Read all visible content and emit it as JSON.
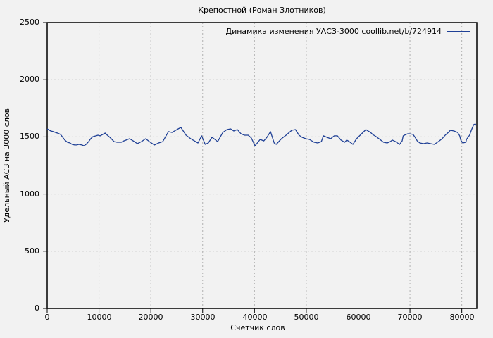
{
  "chart_data": {
    "type": "line",
    "title": "Крепостной (Роман Злотников)",
    "xlabel": "Счетчик слов",
    "ylabel": "Удельный АСЗ на 3000 слов",
    "legend": {
      "label": "Динамика изменения УАСЗ-3000 coollib.net/b/724914",
      "position": "top-right-inside"
    },
    "xlim": [
      0,
      82900
    ],
    "ylim": [
      0,
      2500
    ],
    "xticks": [
      0,
      10000,
      20000,
      30000,
      40000,
      50000,
      60000,
      70000,
      80000
    ],
    "yticks_display": [
      2500,
      2000,
      1500,
      1000,
      500,
      0
    ],
    "grid": true,
    "colors": {
      "background": "#f2f2f2",
      "gridline": "#b0b0b0",
      "axis": "#000000"
    },
    "series": [
      {
        "name": "Динамика изменения УАСЗ-3000 coollib.net/b/724914",
        "color": "#1f4096",
        "points": [
          [
            0,
            1570
          ],
          [
            700,
            1552
          ],
          [
            1200,
            1546
          ],
          [
            1600,
            1539
          ],
          [
            2000,
            1533
          ],
          [
            2600,
            1521
          ],
          [
            3000,
            1496
          ],
          [
            3400,
            1472
          ],
          [
            3900,
            1453
          ],
          [
            4400,
            1447
          ],
          [
            4800,
            1435
          ],
          [
            5300,
            1429
          ],
          [
            5700,
            1429
          ],
          [
            6100,
            1435
          ],
          [
            6700,
            1429
          ],
          [
            7100,
            1422
          ],
          [
            7500,
            1435
          ],
          [
            8000,
            1459
          ],
          [
            8400,
            1484
          ],
          [
            8800,
            1502
          ],
          [
            9400,
            1509
          ],
          [
            9800,
            1515
          ],
          [
            10200,
            1509
          ],
          [
            10700,
            1521
          ],
          [
            11200,
            1533
          ],
          [
            11600,
            1515
          ],
          [
            12100,
            1496
          ],
          [
            12500,
            1478
          ],
          [
            12900,
            1459
          ],
          [
            13500,
            1453
          ],
          [
            14300,
            1453
          ],
          [
            14800,
            1465
          ],
          [
            15900,
            1484
          ],
          [
            16600,
            1465
          ],
          [
            17400,
            1441
          ],
          [
            18200,
            1459
          ],
          [
            19000,
            1484
          ],
          [
            19900,
            1453
          ],
          [
            20700,
            1429
          ],
          [
            21500,
            1447
          ],
          [
            22300,
            1459
          ],
          [
            23400,
            1546
          ],
          [
            24100,
            1539
          ],
          [
            24800,
            1558
          ],
          [
            25800,
            1583
          ],
          [
            26800,
            1515
          ],
          [
            27700,
            1484
          ],
          [
            28400,
            1465
          ],
          [
            29100,
            1447
          ],
          [
            29800,
            1509
          ],
          [
            30500,
            1435
          ],
          [
            31100,
            1447
          ],
          [
            31800,
            1496
          ],
          [
            32200,
            1484
          ],
          [
            32900,
            1459
          ],
          [
            33900,
            1539
          ],
          [
            34700,
            1564
          ],
          [
            35400,
            1570
          ],
          [
            36000,
            1552
          ],
          [
            36700,
            1564
          ],
          [
            37400,
            1527
          ],
          [
            38100,
            1515
          ],
          [
            38800,
            1515
          ],
          [
            39400,
            1490
          ],
          [
            40100,
            1422
          ],
          [
            41100,
            1478
          ],
          [
            41800,
            1465
          ],
          [
            42400,
            1496
          ],
          [
            43100,
            1546
          ],
          [
            43800,
            1447
          ],
          [
            44200,
            1435
          ],
          [
            45200,
            1484
          ],
          [
            46100,
            1515
          ],
          [
            47200,
            1558
          ],
          [
            47900,
            1564
          ],
          [
            48600,
            1515
          ],
          [
            49200,
            1496
          ],
          [
            49900,
            1484
          ],
          [
            50600,
            1478
          ],
          [
            51500,
            1453
          ],
          [
            52200,
            1447
          ],
          [
            52900,
            1459
          ],
          [
            53300,
            1509
          ],
          [
            54000,
            1496
          ],
          [
            54700,
            1484
          ],
          [
            55400,
            1509
          ],
          [
            56000,
            1509
          ],
          [
            56700,
            1472
          ],
          [
            57400,
            1453
          ],
          [
            57800,
            1472
          ],
          [
            58300,
            1459
          ],
          [
            59000,
            1435
          ],
          [
            59700,
            1484
          ],
          [
            60400,
            1515
          ],
          [
            61100,
            1546
          ],
          [
            61500,
            1564
          ],
          [
            61900,
            1552
          ],
          [
            62400,
            1539
          ],
          [
            62800,
            1521
          ],
          [
            63500,
            1502
          ],
          [
            64200,
            1478
          ],
          [
            64900,
            1453
          ],
          [
            65600,
            1447
          ],
          [
            66200,
            1459
          ],
          [
            66600,
            1472
          ],
          [
            67200,
            1459
          ],
          [
            67600,
            1447
          ],
          [
            68000,
            1435
          ],
          [
            68500,
            1465
          ],
          [
            68700,
            1509
          ],
          [
            69200,
            1521
          ],
          [
            69600,
            1527
          ],
          [
            70000,
            1527
          ],
          [
            70600,
            1521
          ],
          [
            71000,
            1496
          ],
          [
            71400,
            1465
          ],
          [
            71900,
            1447
          ],
          [
            72600,
            1441
          ],
          [
            73300,
            1447
          ],
          [
            74000,
            1441
          ],
          [
            74700,
            1435
          ],
          [
            75100,
            1447
          ],
          [
            75500,
            1459
          ],
          [
            76200,
            1484
          ],
          [
            76800,
            1515
          ],
          [
            77400,
            1539
          ],
          [
            77800,
            1558
          ],
          [
            78500,
            1552
          ],
          [
            79200,
            1539
          ],
          [
            79600,
            1509
          ],
          [
            79800,
            1472
          ],
          [
            80100,
            1453
          ],
          [
            80200,
            1447
          ],
          [
            80800,
            1453
          ],
          [
            80900,
            1478
          ],
          [
            81500,
            1515
          ],
          [
            81900,
            1564
          ],
          [
            82300,
            1607
          ],
          [
            82600,
            1613
          ],
          [
            82800,
            1601
          ]
        ]
      }
    ]
  }
}
